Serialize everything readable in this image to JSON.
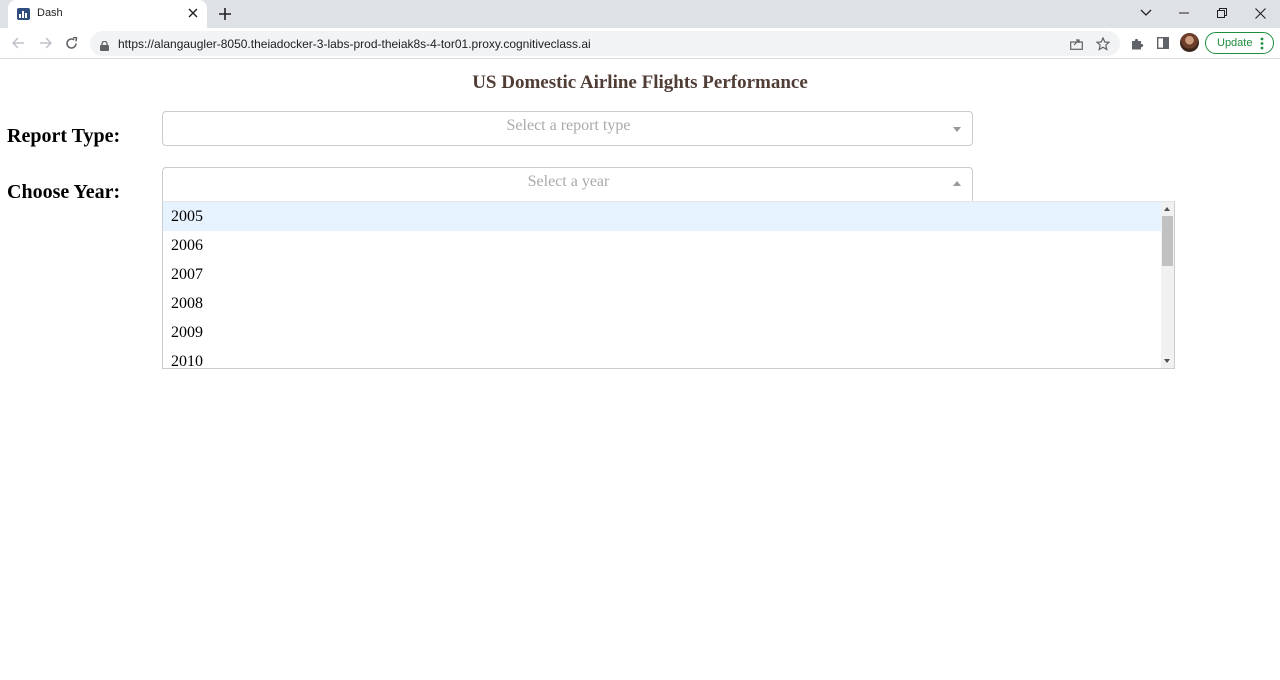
{
  "browser": {
    "tab_title": "Dash",
    "url": "https://alangaugler-8050.theiadocker-3-labs-prod-theiak8s-4-tor01.proxy.cognitiveclass.ai",
    "update_label": "Update",
    "icons": {
      "favicon": "bar-chart-icon",
      "tab_close": "close-icon",
      "new_tab": "plus-icon",
      "tab_search": "chevron-down-icon",
      "minimize": "minimize-icon",
      "restore": "restore-icon",
      "close": "close-icon",
      "back": "arrow-left-icon",
      "forward": "arrow-right-icon",
      "reload": "reload-icon",
      "lock": "lock-icon",
      "share": "share-icon",
      "bookmark": "star-icon",
      "extensions": "puzzle-icon",
      "side_panel": "side-panel-icon",
      "menu": "kebab-icon"
    },
    "colors": {
      "update_accent": "#1e8e3e"
    }
  },
  "page": {
    "title": "US Domestic Airline Flights Performance",
    "title_color": "#503d36",
    "report_type": {
      "label": "Report Type:",
      "placeholder": "Select a report type"
    },
    "year": {
      "label": "Choose Year:",
      "placeholder": "Select a year",
      "options": [
        "2005",
        "2006",
        "2007",
        "2008",
        "2009",
        "2010"
      ],
      "focused_option": "2005",
      "focus_color": "#e6f2fe"
    }
  }
}
